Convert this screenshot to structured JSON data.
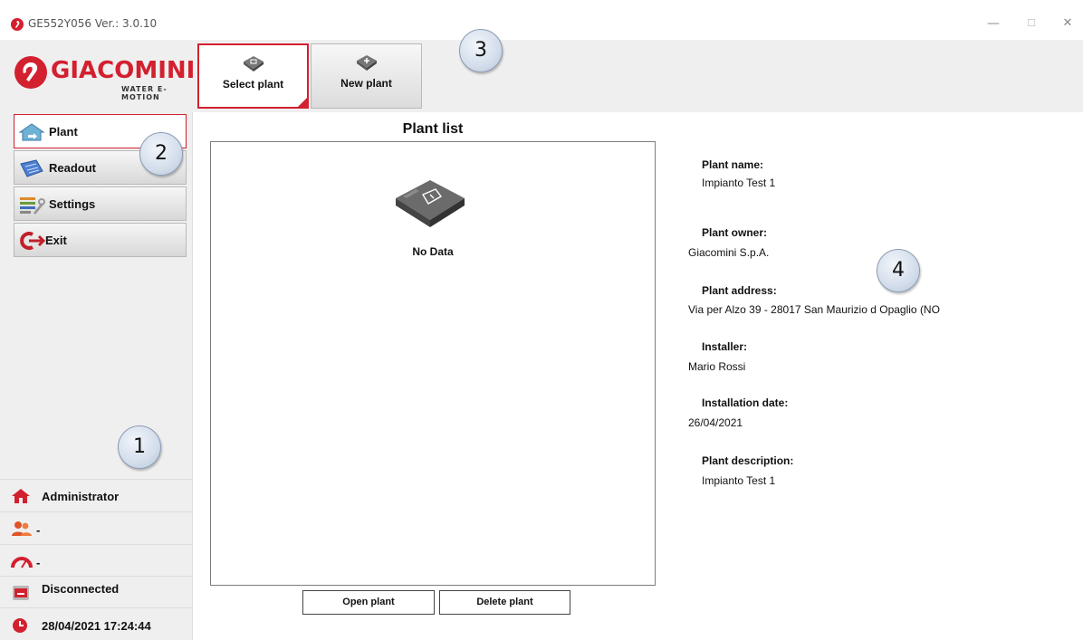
{
  "window": {
    "title": "GE552Y056 Ver.: 3.0.10",
    "minimize": "—",
    "maximize": "☐",
    "close": "✕"
  },
  "logo": {
    "wordmark": "GIACOMINI",
    "tagline": "WATER E-MOTION"
  },
  "tabs": [
    {
      "label": "Select plant",
      "active": true
    },
    {
      "label": "New plant",
      "active": false
    }
  ],
  "sidebar": {
    "items": [
      {
        "label": "Plant",
        "active": true
      },
      {
        "label": "Readout",
        "active": false
      },
      {
        "label": "Settings",
        "active": false
      },
      {
        "label": "Exit",
        "active": false
      }
    ]
  },
  "status": {
    "user": "Administrator",
    "group": "-",
    "meter": "-",
    "connection": "Disconnected",
    "datetime": "28/04/2021 17:24:44"
  },
  "callouts": [
    "1",
    "2",
    "3",
    "4"
  ],
  "plant_list": {
    "title": "Plant list",
    "empty_text": "No Data"
  },
  "actions": {
    "open": "Open plant",
    "delete": "Delete plant"
  },
  "details": [
    {
      "label": "Plant name:",
      "value": "Impianto Test 1"
    },
    {
      "label": "Plant owner:",
      "value": "Giacomini S.p.A."
    },
    {
      "label": "Plant address:",
      "value": "Via per Alzo 39 - 28017 San Maurizio d Opaglio (NO"
    },
    {
      "label": "Installer:",
      "value": "Mario Rossi"
    },
    {
      "label": "Installation date:",
      "value": "26/04/2021"
    },
    {
      "label": "Plant description:",
      "value": "Impianto Test 1"
    }
  ],
  "colors": {
    "brand": "#d3202f",
    "panel": "#efefef"
  }
}
